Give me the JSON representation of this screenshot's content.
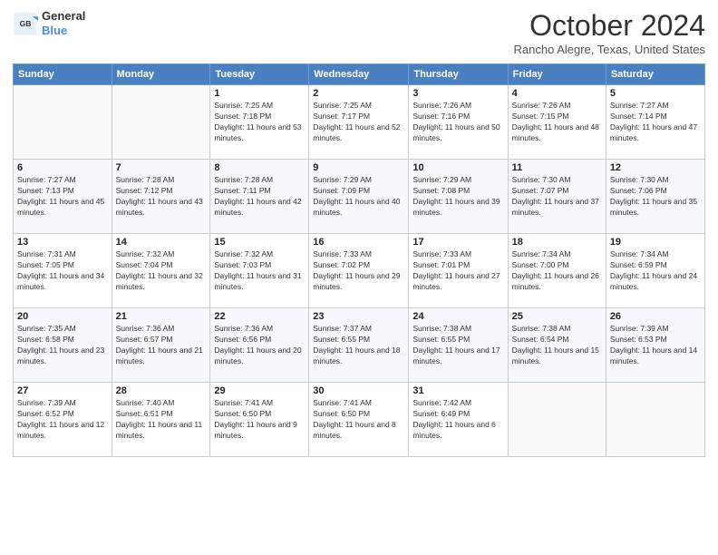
{
  "header": {
    "logo_line1": "General",
    "logo_line2": "Blue",
    "month_title": "October 2024",
    "subtitle": "Rancho Alegre, Texas, United States"
  },
  "days_of_week": [
    "Sunday",
    "Monday",
    "Tuesday",
    "Wednesday",
    "Thursday",
    "Friday",
    "Saturday"
  ],
  "weeks": [
    [
      {
        "day": "",
        "info": ""
      },
      {
        "day": "",
        "info": ""
      },
      {
        "day": "1",
        "info": "Sunrise: 7:25 AM\nSunset: 7:18 PM\nDaylight: 11 hours and 53 minutes."
      },
      {
        "day": "2",
        "info": "Sunrise: 7:25 AM\nSunset: 7:17 PM\nDaylight: 11 hours and 52 minutes."
      },
      {
        "day": "3",
        "info": "Sunrise: 7:26 AM\nSunset: 7:16 PM\nDaylight: 11 hours and 50 minutes."
      },
      {
        "day": "4",
        "info": "Sunrise: 7:26 AM\nSunset: 7:15 PM\nDaylight: 11 hours and 48 minutes."
      },
      {
        "day": "5",
        "info": "Sunrise: 7:27 AM\nSunset: 7:14 PM\nDaylight: 11 hours and 47 minutes."
      }
    ],
    [
      {
        "day": "6",
        "info": "Sunrise: 7:27 AM\nSunset: 7:13 PM\nDaylight: 11 hours and 45 minutes."
      },
      {
        "day": "7",
        "info": "Sunrise: 7:28 AM\nSunset: 7:12 PM\nDaylight: 11 hours and 43 minutes."
      },
      {
        "day": "8",
        "info": "Sunrise: 7:28 AM\nSunset: 7:11 PM\nDaylight: 11 hours and 42 minutes."
      },
      {
        "day": "9",
        "info": "Sunrise: 7:29 AM\nSunset: 7:09 PM\nDaylight: 11 hours and 40 minutes."
      },
      {
        "day": "10",
        "info": "Sunrise: 7:29 AM\nSunset: 7:08 PM\nDaylight: 11 hours and 39 minutes."
      },
      {
        "day": "11",
        "info": "Sunrise: 7:30 AM\nSunset: 7:07 PM\nDaylight: 11 hours and 37 minutes."
      },
      {
        "day": "12",
        "info": "Sunrise: 7:30 AM\nSunset: 7:06 PM\nDaylight: 11 hours and 35 minutes."
      }
    ],
    [
      {
        "day": "13",
        "info": "Sunrise: 7:31 AM\nSunset: 7:05 PM\nDaylight: 11 hours and 34 minutes."
      },
      {
        "day": "14",
        "info": "Sunrise: 7:32 AM\nSunset: 7:04 PM\nDaylight: 11 hours and 32 minutes."
      },
      {
        "day": "15",
        "info": "Sunrise: 7:32 AM\nSunset: 7:03 PM\nDaylight: 11 hours and 31 minutes."
      },
      {
        "day": "16",
        "info": "Sunrise: 7:33 AM\nSunset: 7:02 PM\nDaylight: 11 hours and 29 minutes."
      },
      {
        "day": "17",
        "info": "Sunrise: 7:33 AM\nSunset: 7:01 PM\nDaylight: 11 hours and 27 minutes."
      },
      {
        "day": "18",
        "info": "Sunrise: 7:34 AM\nSunset: 7:00 PM\nDaylight: 11 hours and 26 minutes."
      },
      {
        "day": "19",
        "info": "Sunrise: 7:34 AM\nSunset: 6:59 PM\nDaylight: 11 hours and 24 minutes."
      }
    ],
    [
      {
        "day": "20",
        "info": "Sunrise: 7:35 AM\nSunset: 6:58 PM\nDaylight: 11 hours and 23 minutes."
      },
      {
        "day": "21",
        "info": "Sunrise: 7:36 AM\nSunset: 6:57 PM\nDaylight: 11 hours and 21 minutes."
      },
      {
        "day": "22",
        "info": "Sunrise: 7:36 AM\nSunset: 6:56 PM\nDaylight: 11 hours and 20 minutes."
      },
      {
        "day": "23",
        "info": "Sunrise: 7:37 AM\nSunset: 6:55 PM\nDaylight: 11 hours and 18 minutes."
      },
      {
        "day": "24",
        "info": "Sunrise: 7:38 AM\nSunset: 6:55 PM\nDaylight: 11 hours and 17 minutes."
      },
      {
        "day": "25",
        "info": "Sunrise: 7:38 AM\nSunset: 6:54 PM\nDaylight: 11 hours and 15 minutes."
      },
      {
        "day": "26",
        "info": "Sunrise: 7:39 AM\nSunset: 6:53 PM\nDaylight: 11 hours and 14 minutes."
      }
    ],
    [
      {
        "day": "27",
        "info": "Sunrise: 7:39 AM\nSunset: 6:52 PM\nDaylight: 11 hours and 12 minutes."
      },
      {
        "day": "28",
        "info": "Sunrise: 7:40 AM\nSunset: 6:51 PM\nDaylight: 11 hours and 11 minutes."
      },
      {
        "day": "29",
        "info": "Sunrise: 7:41 AM\nSunset: 6:50 PM\nDaylight: 11 hours and 9 minutes."
      },
      {
        "day": "30",
        "info": "Sunrise: 7:41 AM\nSunset: 6:50 PM\nDaylight: 11 hours and 8 minutes."
      },
      {
        "day": "31",
        "info": "Sunrise: 7:42 AM\nSunset: 6:49 PM\nDaylight: 11 hours and 6 minutes."
      },
      {
        "day": "",
        "info": ""
      },
      {
        "day": "",
        "info": ""
      }
    ]
  ]
}
